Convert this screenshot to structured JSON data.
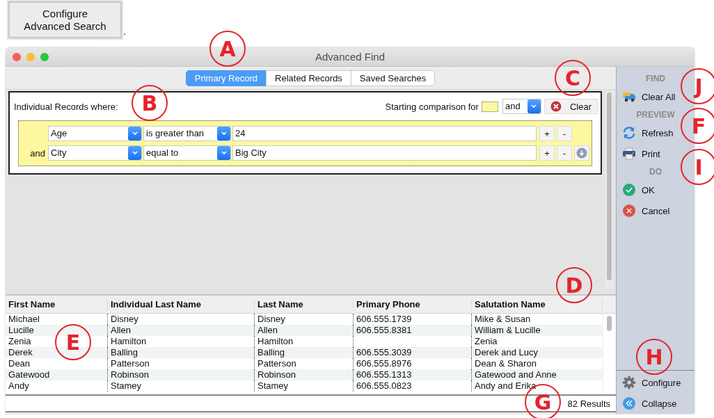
{
  "top_button": {
    "label": "Configure\nAdvanced Search"
  },
  "top_mark": ".",
  "window": {
    "title": "Advanced Find"
  },
  "tabs": [
    {
      "label": "Primary Record",
      "selected": true
    },
    {
      "label": "Related Records",
      "selected": false
    },
    {
      "label": "Saved Searches",
      "selected": false
    }
  ],
  "criteria": {
    "heading": "Individual Records where:",
    "starting_label": "Starting comparison for",
    "starting_operator": "and",
    "clear_button": "Clear",
    "rows": [
      {
        "field": "Age",
        "operator": "is greater than",
        "value": "24",
        "add": "+",
        "remove": "-",
        "info_button": false
      },
      {
        "conjunction": "and",
        "field": "City",
        "operator": "equal to",
        "value": "Big City",
        "add": "+",
        "remove": "-",
        "info_button": true
      }
    ]
  },
  "table": {
    "columns": [
      "First Name",
      "Individual Last Name",
      "Last Name",
      "Primary Phone",
      "Salutation Name"
    ],
    "rows": [
      [
        "Michael",
        "Disney",
        "Disney",
        "606.555.1739",
        "Mike & Susan"
      ],
      [
        "Lucille",
        "Allen",
        "Allen",
        "606.555.8381",
        "William & Lucille"
      ],
      [
        "Zenia",
        "Hamilton",
        "Hamilton",
        "",
        "Zenia"
      ],
      [
        "Derek",
        "Balling",
        "Balling",
        "606.555.3039",
        "Derek and Lucy"
      ],
      [
        "Dean",
        "Patterson",
        "Patterson",
        "606.555.8976",
        "Dean & Sharon"
      ],
      [
        "Gatewood",
        "Robinson",
        "Robinson",
        "606.555.1313",
        "Gatewood and Anne"
      ],
      [
        "Andy",
        "Stamey",
        "Stamey",
        "606.555.0823",
        "Andy and Erika"
      ]
    ]
  },
  "status_bar": {
    "results": "82 Results"
  },
  "sidebar": {
    "sections": [
      {
        "heading": "FIND",
        "items": [
          {
            "label": "Clear All",
            "kind": "truck"
          }
        ]
      },
      {
        "heading": "PREVIEW",
        "items": [
          {
            "label": "Refresh",
            "kind": "refresh"
          },
          {
            "label": "Print",
            "kind": "printer"
          }
        ]
      },
      {
        "heading": "DO",
        "items": [
          {
            "label": "OK",
            "kind": "ok"
          },
          {
            "label": "Cancel",
            "kind": "cancel"
          }
        ]
      }
    ],
    "bottom_items": [
      {
        "label": "Configure",
        "kind": "gear"
      },
      {
        "label": "Collapse",
        "kind": "collapse"
      }
    ]
  },
  "callouts": [
    {
      "letter": "A"
    },
    {
      "letter": "C"
    },
    {
      "letter": "J"
    },
    {
      "letter": "B"
    },
    {
      "letter": "F"
    },
    {
      "letter": "I"
    },
    {
      "letter": "D"
    },
    {
      "letter": "E"
    },
    {
      "letter": "H"
    },
    {
      "letter": "G"
    }
  ]
}
